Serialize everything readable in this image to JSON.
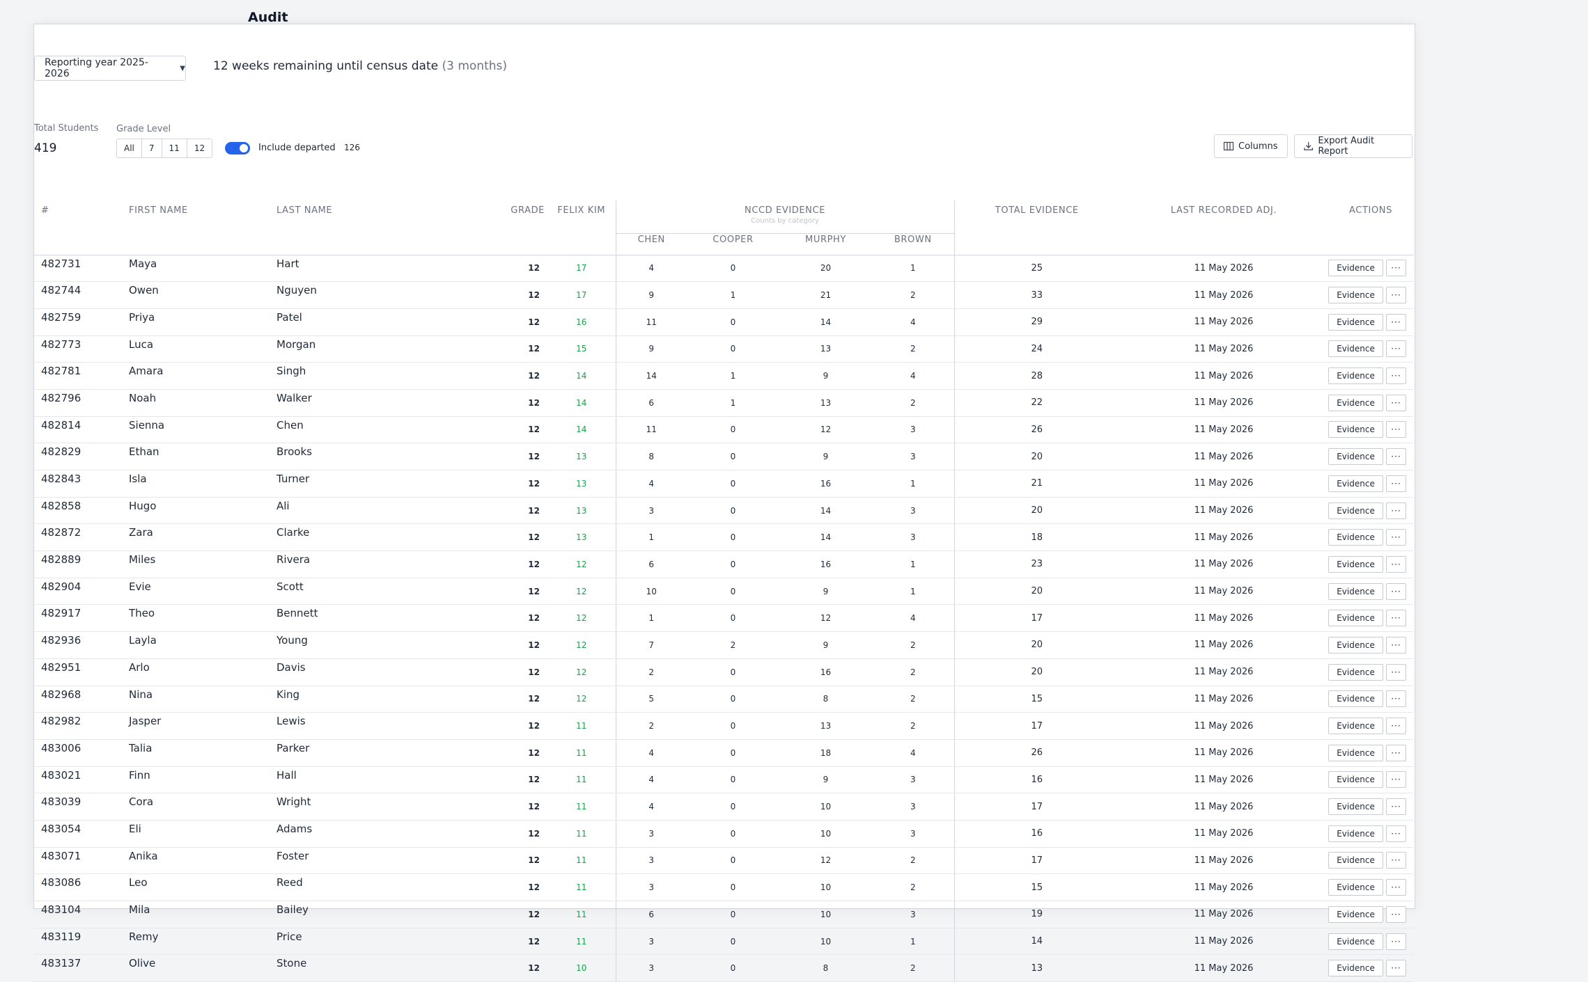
{
  "page": {
    "title": "Audit"
  },
  "controls": {
    "year_select": "Reporting year 2025-2026",
    "census_main": "12 weeks remaining until census date",
    "census_sub": "(3 months)",
    "total_students_label": "Total Students",
    "total_students_value": "419",
    "grade_level_label": "Grade Level",
    "grade_options": [
      "All",
      "7",
      "11",
      "12"
    ],
    "include_departed_label": "Include departed",
    "include_departed_on": true,
    "departed_count": "126",
    "columns_label": "Columns",
    "export_label": "Export Audit Report"
  },
  "table": {
    "headers": {
      "id": "#",
      "first_name": "First Name",
      "last_name": "Last Name",
      "grade": "Grade",
      "felix": "Felix Kim",
      "nccd": "NCCD Evidence",
      "nccd_sub": "Counts by category",
      "chen": "Chen",
      "cooper": "Cooper",
      "murphy": "Murphy",
      "brown": "Brown",
      "total": "Total Evidence",
      "last_adj": "Last Recorded Adj.",
      "actions": "Actions"
    },
    "evidence_label": "Evidence",
    "more_label": "···",
    "rows": [
      {
        "id": "482731",
        "first": "Maya",
        "last": "Hart",
        "grade": "12",
        "felix": "17",
        "chen": "4",
        "cooper": "0",
        "murphy": "20",
        "brown": "1",
        "total": "25",
        "date": "11 May 2026"
      },
      {
        "id": "482744",
        "first": "Owen",
        "last": "Nguyen",
        "grade": "12",
        "felix": "17",
        "chen": "9",
        "cooper": "1",
        "murphy": "21",
        "brown": "2",
        "total": "33",
        "date": "11 May 2026"
      },
      {
        "id": "482759",
        "first": "Priya",
        "last": "Patel",
        "grade": "12",
        "felix": "16",
        "chen": "11",
        "cooper": "0",
        "murphy": "14",
        "brown": "4",
        "total": "29",
        "date": "11 May 2026"
      },
      {
        "id": "482773",
        "first": "Luca",
        "last": "Morgan",
        "grade": "12",
        "felix": "15",
        "chen": "9",
        "cooper": "0",
        "murphy": "13",
        "brown": "2",
        "total": "24",
        "date": "11 May 2026"
      },
      {
        "id": "482781",
        "first": "Amara",
        "last": "Singh",
        "grade": "12",
        "felix": "14",
        "chen": "14",
        "cooper": "1",
        "murphy": "9",
        "brown": "4",
        "total": "28",
        "date": "11 May 2026"
      },
      {
        "id": "482796",
        "first": "Noah",
        "last": "Walker",
        "grade": "12",
        "felix": "14",
        "chen": "6",
        "cooper": "1",
        "murphy": "13",
        "brown": "2",
        "total": "22",
        "date": "11 May 2026"
      },
      {
        "id": "482814",
        "first": "Sienna",
        "last": "Chen",
        "grade": "12",
        "felix": "14",
        "chen": "11",
        "cooper": "0",
        "murphy": "12",
        "brown": "3",
        "total": "26",
        "date": "11 May 2026"
      },
      {
        "id": "482829",
        "first": "Ethan",
        "last": "Brooks",
        "grade": "12",
        "felix": "13",
        "chen": "8",
        "cooper": "0",
        "murphy": "9",
        "brown": "3",
        "total": "20",
        "date": "11 May 2026"
      },
      {
        "id": "482843",
        "first": "Isla",
        "last": "Turner",
        "grade": "12",
        "felix": "13",
        "chen": "4",
        "cooper": "0",
        "murphy": "16",
        "brown": "1",
        "total": "21",
        "date": "11 May 2026"
      },
      {
        "id": "482858",
        "first": "Hugo",
        "last": "Ali",
        "grade": "12",
        "felix": "13",
        "chen": "3",
        "cooper": "0",
        "murphy": "14",
        "brown": "3",
        "total": "20",
        "date": "11 May 2026"
      },
      {
        "id": "482872",
        "first": "Zara",
        "last": "Clarke",
        "grade": "12",
        "felix": "13",
        "chen": "1",
        "cooper": "0",
        "murphy": "14",
        "brown": "3",
        "total": "18",
        "date": "11 May 2026"
      },
      {
        "id": "482889",
        "first": "Miles",
        "last": "Rivera",
        "grade": "12",
        "felix": "12",
        "chen": "6",
        "cooper": "0",
        "murphy": "16",
        "brown": "1",
        "total": "23",
        "date": "11 May 2026"
      },
      {
        "id": "482904",
        "first": "Evie",
        "last": "Scott",
        "grade": "12",
        "felix": "12",
        "chen": "10",
        "cooper": "0",
        "murphy": "9",
        "brown": "1",
        "total": "20",
        "date": "11 May 2026"
      },
      {
        "id": "482917",
        "first": "Theo",
        "last": "Bennett",
        "grade": "12",
        "felix": "12",
        "chen": "1",
        "cooper": "0",
        "murphy": "12",
        "brown": "4",
        "total": "17",
        "date": "11 May 2026"
      },
      {
        "id": "482936",
        "first": "Layla",
        "last": "Young",
        "grade": "12",
        "felix": "12",
        "chen": "7",
        "cooper": "2",
        "murphy": "9",
        "brown": "2",
        "total": "20",
        "date": "11 May 2026"
      },
      {
        "id": "482951",
        "first": "Arlo",
        "last": "Davis",
        "grade": "12",
        "felix": "12",
        "chen": "2",
        "cooper": "0",
        "murphy": "16",
        "brown": "2",
        "total": "20",
        "date": "11 May 2026"
      },
      {
        "id": "482968",
        "first": "Nina",
        "last": "King",
        "grade": "12",
        "felix": "12",
        "chen": "5",
        "cooper": "0",
        "murphy": "8",
        "brown": "2",
        "total": "15",
        "date": "11 May 2026"
      },
      {
        "id": "482982",
        "first": "Jasper",
        "last": "Lewis",
        "grade": "12",
        "felix": "11",
        "chen": "2",
        "cooper": "0",
        "murphy": "13",
        "brown": "2",
        "total": "17",
        "date": "11 May 2026"
      },
      {
        "id": "483006",
        "first": "Talia",
        "last": "Parker",
        "grade": "12",
        "felix": "11",
        "chen": "4",
        "cooper": "0",
        "murphy": "18",
        "brown": "4",
        "total": "26",
        "date": "11 May 2026"
      },
      {
        "id": "483021",
        "first": "Finn",
        "last": "Hall",
        "grade": "12",
        "felix": "11",
        "chen": "4",
        "cooper": "0",
        "murphy": "9",
        "brown": "3",
        "total": "16",
        "date": "11 May 2026"
      },
      {
        "id": "483039",
        "first": "Cora",
        "last": "Wright",
        "grade": "12",
        "felix": "11",
        "chen": "4",
        "cooper": "0",
        "murphy": "10",
        "brown": "3",
        "total": "17",
        "date": "11 May 2026"
      },
      {
        "id": "483054",
        "first": "Eli",
        "last": "Adams",
        "grade": "12",
        "felix": "11",
        "chen": "3",
        "cooper": "0",
        "murphy": "10",
        "brown": "3",
        "total": "16",
        "date": "11 May 2026"
      },
      {
        "id": "483071",
        "first": "Anika",
        "last": "Foster",
        "grade": "12",
        "felix": "11",
        "chen": "3",
        "cooper": "0",
        "murphy": "12",
        "brown": "2",
        "total": "17",
        "date": "11 May 2026"
      },
      {
        "id": "483086",
        "first": "Leo",
        "last": "Reed",
        "grade": "12",
        "felix": "11",
        "chen": "3",
        "cooper": "0",
        "murphy": "10",
        "brown": "2",
        "total": "15",
        "date": "11 May 2026"
      },
      {
        "id": "483104",
        "first": "Mila",
        "last": "Bailey",
        "grade": "12",
        "felix": "11",
        "chen": "6",
        "cooper": "0",
        "murphy": "10",
        "brown": "3",
        "total": "19",
        "date": "11 May 2026"
      },
      {
        "id": "483119",
        "first": "Remy",
        "last": "Price",
        "grade": "12",
        "felix": "11",
        "chen": "3",
        "cooper": "0",
        "murphy": "10",
        "brown": "1",
        "total": "14",
        "date": "11 May 2026"
      },
      {
        "id": "483137",
        "first": "Olive",
        "last": "Stone",
        "grade": "12",
        "felix": "10",
        "chen": "3",
        "cooper": "0",
        "murphy": "8",
        "brown": "2",
        "total": "13",
        "date": "11 May 2026"
      }
    ]
  }
}
